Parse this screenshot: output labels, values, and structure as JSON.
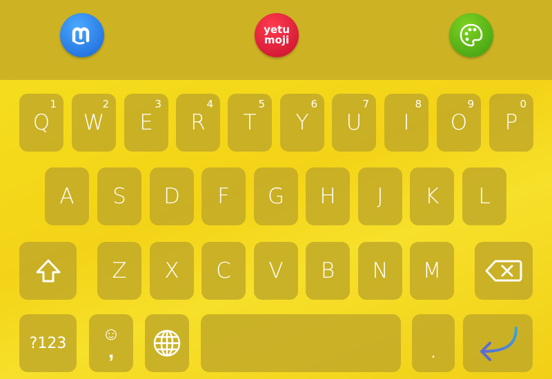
{
  "toolbar": {
    "apps": [
      {
        "name": "mastodon",
        "icon": "mastodon-icon"
      },
      {
        "name": "yetumoji",
        "label_top": "yetu",
        "label_bottom": "moji"
      },
      {
        "name": "themes",
        "icon": "palette-icon"
      }
    ]
  },
  "keyboard": {
    "row1": [
      {
        "label": "Q",
        "hint": "1"
      },
      {
        "label": "W",
        "hint": "2"
      },
      {
        "label": "E",
        "hint": "3"
      },
      {
        "label": "R",
        "hint": "4"
      },
      {
        "label": "T",
        "hint": "5"
      },
      {
        "label": "Y",
        "hint": "6"
      },
      {
        "label": "U",
        "hint": "7"
      },
      {
        "label": "I",
        "hint": "8"
      },
      {
        "label": "O",
        "hint": "9"
      },
      {
        "label": "P",
        "hint": "0"
      }
    ],
    "row2": [
      "A",
      "S",
      "D",
      "F",
      "G",
      "H",
      "J",
      "K",
      "L"
    ],
    "row3": [
      "Z",
      "X",
      "C",
      "V",
      "B",
      "N",
      "M"
    ],
    "row4": {
      "symbols_label": "?123",
      "emoji_label": "☺",
      "comma_label": ",",
      "period_label": ".",
      "shift_icon": "shift-arrow-icon",
      "backspace_icon": "backspace-icon",
      "globe_icon": "globe-icon",
      "enter_icon": "enter-arrow-icon"
    }
  },
  "colors": {
    "toolbar_bg": "#cdb324",
    "keyboard_bg": "#f4d81a",
    "key_bg": "#c0a528",
    "key_text": "#ffffff",
    "enter_arrow": "#4a6ed1"
  }
}
